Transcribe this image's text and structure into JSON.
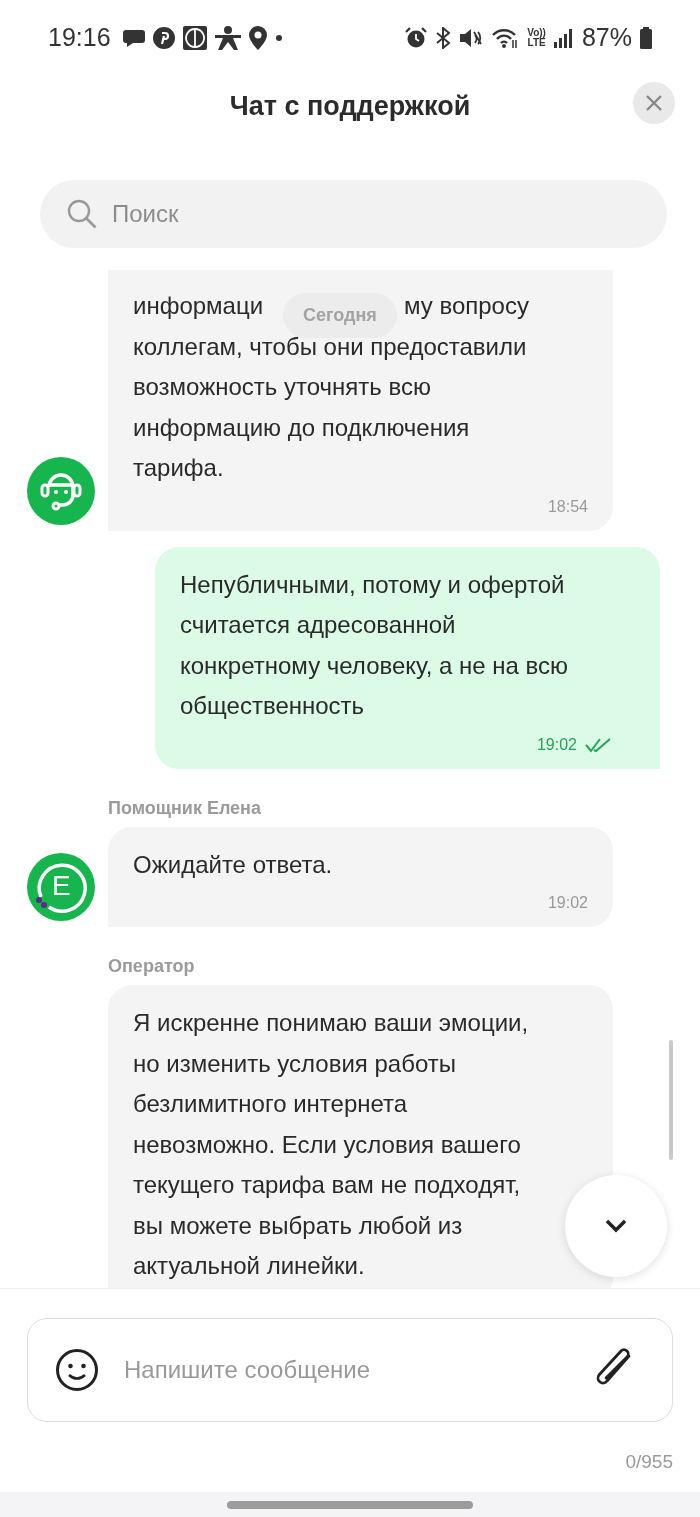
{
  "status_bar": {
    "time": "19:16",
    "volte": [
      "Vo))",
      "LTE"
    ],
    "battery": "87%"
  },
  "header": {
    "title": "Чат с поддержкой"
  },
  "search": {
    "placeholder": "Поиск"
  },
  "date_badge": "Сегодня",
  "messages": [
    {
      "kind": "incoming",
      "avatar": {
        "kind": "headset"
      },
      "covered_line": [
        "информаци",
        "му вопросу"
      ],
      "text": "коллегам, чтобы они предоставили\nвозможность уточнять всю\nинформацию до подключения\nтарифа.",
      "time": "18:54"
    },
    {
      "kind": "outgoing",
      "text": "Непубличными, потому и офертой\nсчитается адресованной\nконкретному человеку, а не на всю\nобщественность",
      "time": "19:02",
      "read": true
    },
    {
      "kind": "incoming",
      "sender": "Помощник Елена",
      "avatar": {
        "kind": "letter",
        "letter": "E"
      },
      "text": "Ожидайте ответа.",
      "time": "19:02"
    },
    {
      "kind": "incoming",
      "sender": "Оператор",
      "text": "Я искренне понимаю ваши эмоции,\nно изменить условия работы\nбезлимитного интернета\nневозможно. Если условия вашего\nтекущего тарифа вам не подходят,\nвы можете выбрать любой из\nактуальной линейки."
    }
  ],
  "composer": {
    "placeholder": "Напишите сообщение",
    "counter": "0/955"
  }
}
